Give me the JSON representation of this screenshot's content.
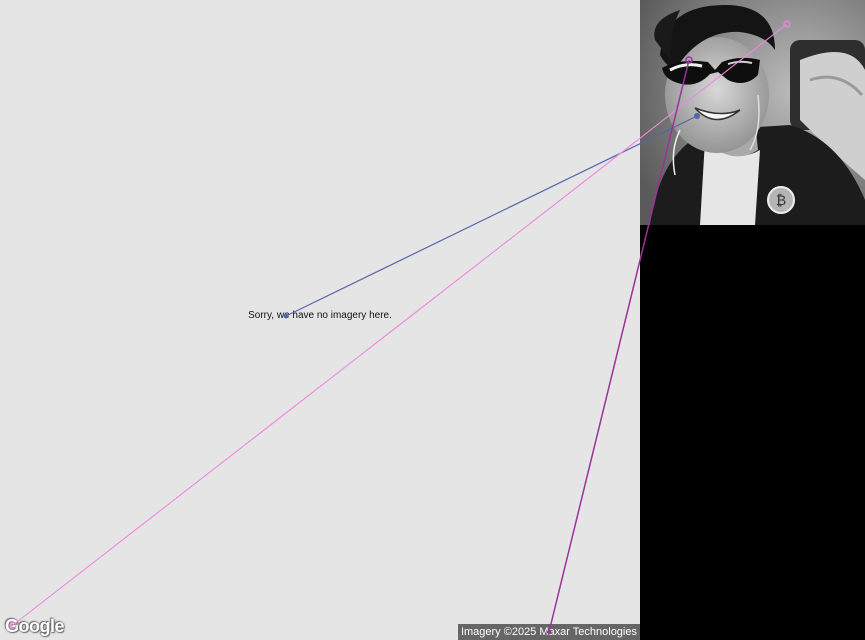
{
  "map": {
    "no_imagery_message": "Sorry, we have no imagery here.",
    "logo_text": "Google",
    "attribution": "Imagery ©2025 Maxar Technologies",
    "background_color": "#e5e5e5"
  },
  "webcam": {
    "description_icon": "webcam-portrait-image",
    "badge_icon": "bitcoin-badge-icon"
  },
  "overlay": {
    "colors": {
      "blue_line": "#5566aa",
      "pink_line": "#ee88dd",
      "purple_line": "#993399"
    }
  }
}
